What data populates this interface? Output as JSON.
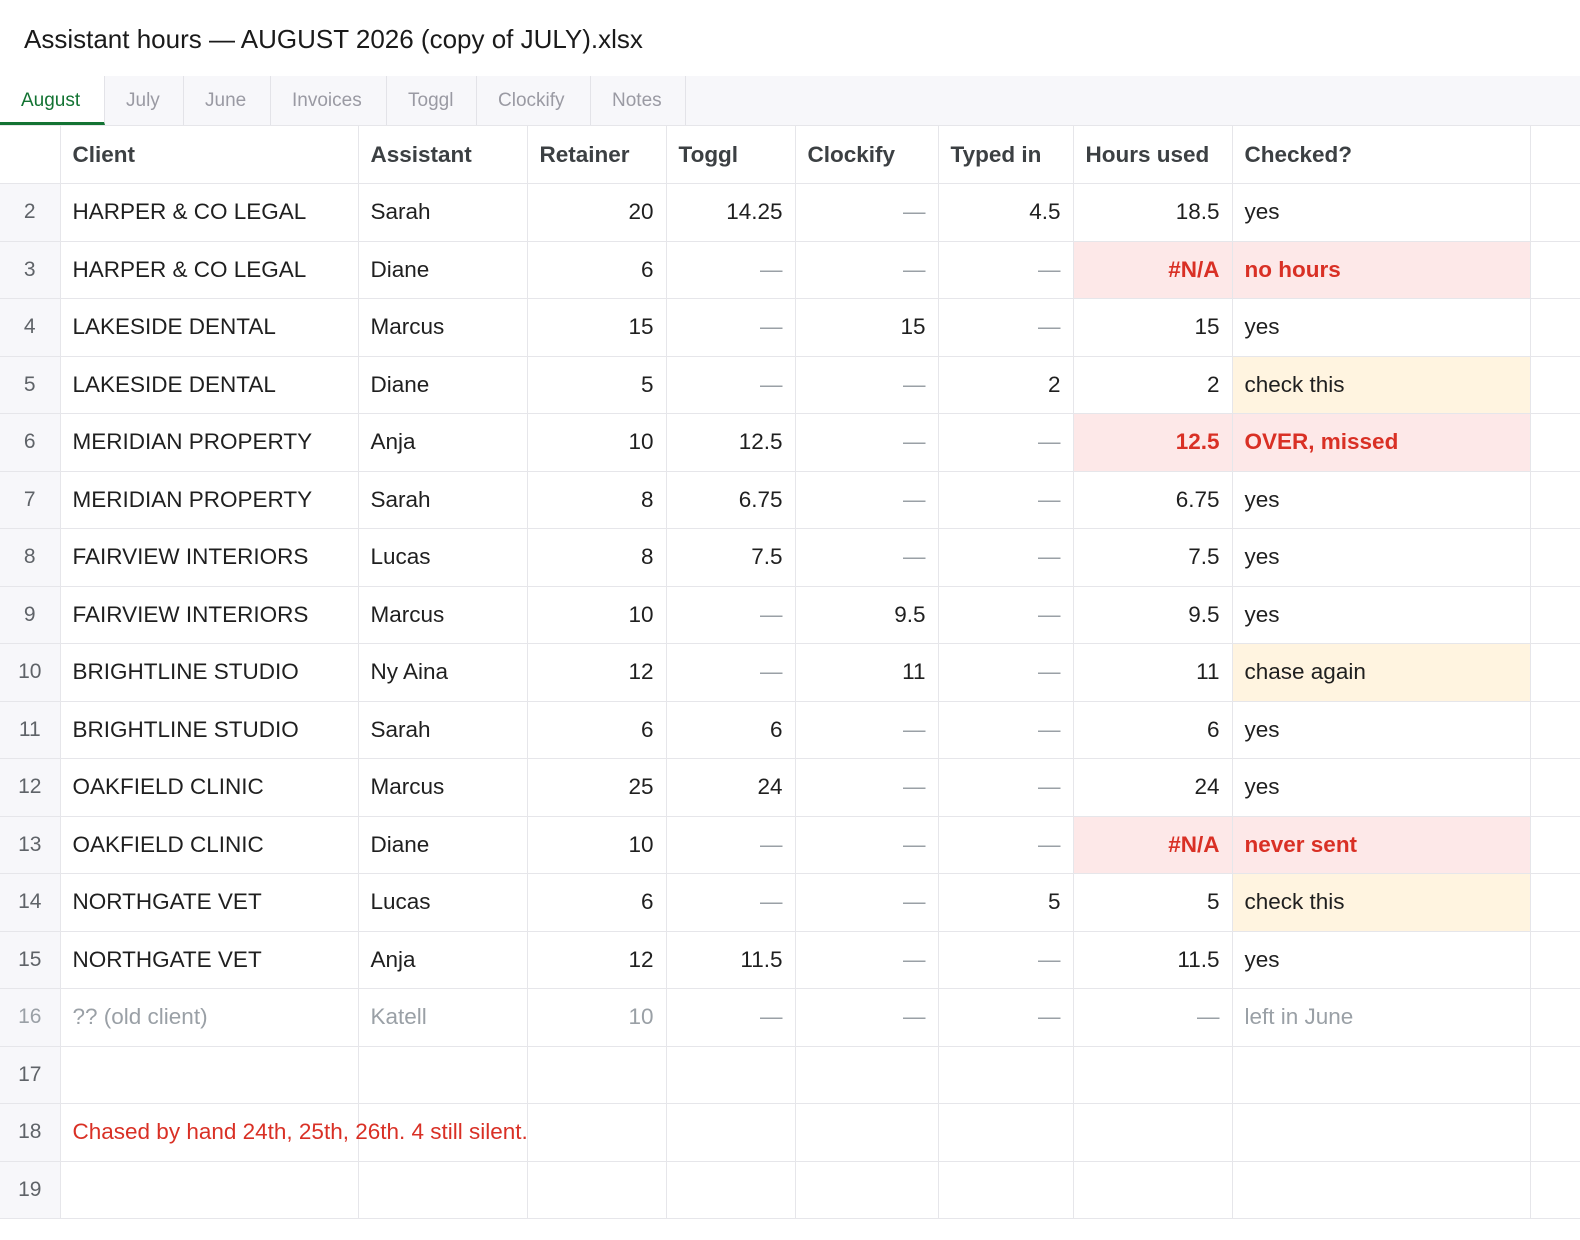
{
  "window": {
    "title": "Assistant hours — AUGUST 2026 (copy of JULY).xlsx"
  },
  "tabs": [
    "August",
    "July",
    "June",
    "Invoices",
    "Toggl",
    "Clockify",
    "Notes"
  ],
  "active_tab": "August",
  "colors": {
    "accent": "#137333",
    "error_bg": "#fde8e8",
    "error_text": "#d93025",
    "warn_bg": "#fff4e0",
    "muted_text": "#9aa0a6"
  },
  "header": {
    "row_num": "1",
    "columns": [
      "Client",
      "Assistant",
      "Retainer",
      "Toggl",
      "Clockify",
      "Typed in",
      "Hours used",
      "Checked?"
    ]
  },
  "rows": [
    {
      "n": "2",
      "client": "HARPER & CO LEGAL",
      "assistant": "Sarah",
      "retainer": "20",
      "toggl": "14.25",
      "clockify": "—",
      "typed": "4.5",
      "used": "18.5",
      "checked": "yes"
    },
    {
      "n": "3",
      "client": "HARPER & CO LEGAL",
      "assistant": "Diane",
      "retainer": "6",
      "toggl": "—",
      "clockify": "—",
      "typed": "—",
      "used": "#N/A",
      "checked": "no hours"
    },
    {
      "n": "4",
      "client": "LAKESIDE DENTAL",
      "assistant": "Marcus",
      "retainer": "15",
      "toggl": "—",
      "clockify": "15",
      "typed": "—",
      "used": "15",
      "checked": "yes"
    },
    {
      "n": "5",
      "client": "LAKESIDE DENTAL",
      "assistant": "Diane",
      "retainer": "5",
      "toggl": "—",
      "clockify": "—",
      "typed": "2",
      "used": "2",
      "checked": "check this"
    },
    {
      "n": "6",
      "client": "MERIDIAN PROPERTY",
      "assistant": "Anja",
      "retainer": "10",
      "toggl": "12.5",
      "clockify": "—",
      "typed": "—",
      "used": "12.5",
      "checked": "OVER, missed"
    },
    {
      "n": "7",
      "client": "MERIDIAN PROPERTY",
      "assistant": "Sarah",
      "retainer": "8",
      "toggl": "6.75",
      "clockify": "—",
      "typed": "—",
      "used": "6.75",
      "checked": "yes"
    },
    {
      "n": "8",
      "client": "FAIRVIEW INTERIORS",
      "assistant": "Lucas",
      "retainer": "8",
      "toggl": "7.5",
      "clockify": "—",
      "typed": "—",
      "used": "7.5",
      "checked": "yes"
    },
    {
      "n": "9",
      "client": "FAIRVIEW INTERIORS",
      "assistant": "Marcus",
      "retainer": "10",
      "toggl": "—",
      "clockify": "9.5",
      "typed": "—",
      "used": "9.5",
      "checked": "yes"
    },
    {
      "n": "10",
      "client": "BRIGHTLINE STUDIO",
      "assistant": "Ny Aina",
      "retainer": "12",
      "toggl": "—",
      "clockify": "11",
      "typed": "—",
      "used": "11",
      "checked": "chase again"
    },
    {
      "n": "11",
      "client": "BRIGHTLINE STUDIO",
      "assistant": "Sarah",
      "retainer": "6",
      "toggl": "6",
      "clockify": "—",
      "typed": "—",
      "used": "6",
      "checked": "yes"
    },
    {
      "n": "12",
      "client": "OAKFIELD CLINIC",
      "assistant": "Marcus",
      "retainer": "25",
      "toggl": "24",
      "clockify": "—",
      "typed": "—",
      "used": "24",
      "checked": "yes"
    },
    {
      "n": "13",
      "client": "OAKFIELD CLINIC",
      "assistant": "Diane",
      "retainer": "10",
      "toggl": "—",
      "clockify": "—",
      "typed": "—",
      "used": "#N/A",
      "checked": "never sent"
    },
    {
      "n": "14",
      "client": "NORTHGATE VET",
      "assistant": "Lucas",
      "retainer": "6",
      "toggl": "—",
      "clockify": "—",
      "typed": "5",
      "used": "5",
      "checked": "check this"
    },
    {
      "n": "15",
      "client": "NORTHGATE VET",
      "assistant": "Anja",
      "retainer": "12",
      "toggl": "11.5",
      "clockify": "—",
      "typed": "—",
      "used": "11.5",
      "checked": "yes"
    },
    {
      "n": "16",
      "client": "?? (old client)",
      "assistant": "Katell",
      "retainer": "10",
      "toggl": "—",
      "clockify": "—",
      "typed": "—",
      "used": "—",
      "checked": "left in June"
    }
  ],
  "empty_row_17": {
    "n": "17"
  },
  "note_row": {
    "n": "18",
    "text": "Chased by hand 24th, 25th, 26th. 4 still silent."
  },
  "empty_row_19": {
    "n": "19"
  }
}
